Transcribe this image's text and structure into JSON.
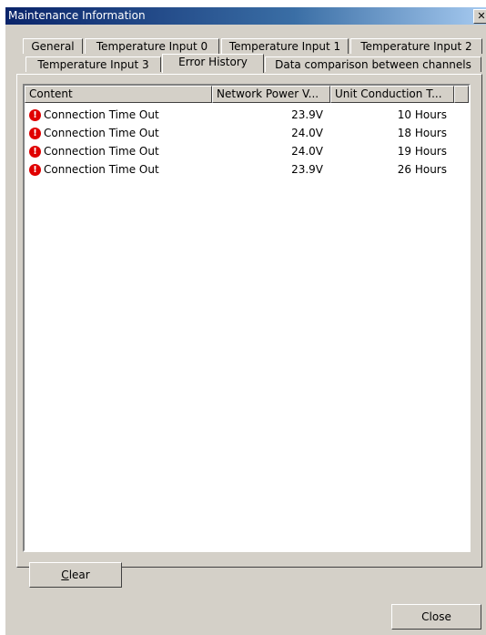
{
  "window": {
    "title": "Maintenance Information",
    "close_glyph": "✕"
  },
  "tabs": {
    "row1": [
      "General",
      "Temperature Input 0",
      "Temperature Input 1",
      "Temperature Input 2"
    ],
    "row2": [
      "Temperature Input 3",
      "Error History",
      "Data comparison between channels"
    ],
    "active": "Error History"
  },
  "table": {
    "columns": [
      "Content",
      "Network Power V...",
      "Unit Conduction T..."
    ],
    "rows": [
      {
        "icon": "error-icon",
        "content": "Connection Time Out",
        "voltage": "23.9V",
        "time": "10 Hours"
      },
      {
        "icon": "error-icon",
        "content": "Connection Time Out",
        "voltage": "24.0V",
        "time": "18 Hours"
      },
      {
        "icon": "error-icon",
        "content": "Connection Time Out",
        "voltage": "24.0V",
        "time": "19 Hours"
      },
      {
        "icon": "error-icon",
        "content": "Connection Time Out",
        "voltage": "23.9V",
        "time": "26 Hours"
      }
    ]
  },
  "buttons": {
    "clear_first": "C",
    "clear_rest": "lear",
    "close": "Close"
  },
  "colors": {
    "title_bar": "#0a246a",
    "face": "#d4d0c8",
    "error": "#e00000"
  }
}
